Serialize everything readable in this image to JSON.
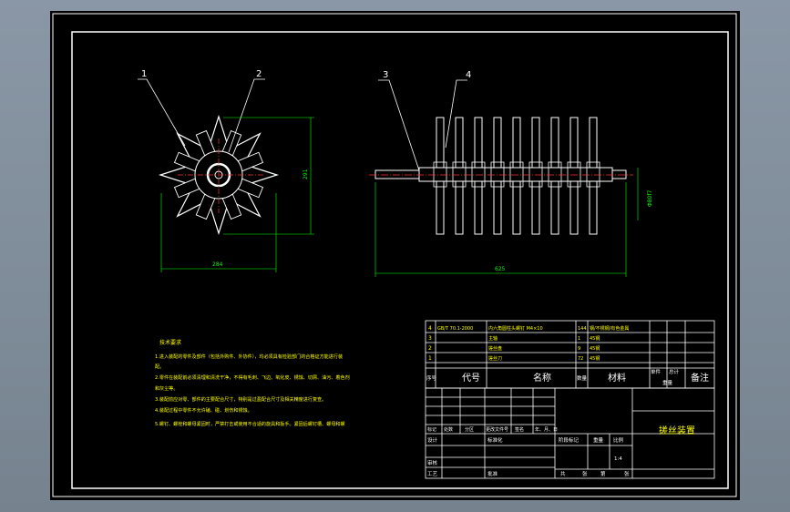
{
  "colors": {
    "background": "#000000",
    "frame": "#ffffff",
    "dimension": "#00ff00",
    "centerline": "#ff3333",
    "notes": "#ffff00",
    "chrome": "#7f8c99"
  },
  "front_view": {
    "callout_1": "1",
    "callout_2": "2",
    "dim_height": "291",
    "dim_width": "284"
  },
  "side_view": {
    "callout_3": "3",
    "callout_4": "4",
    "dim_diameter": "Φ80f7",
    "dim_length": "625"
  },
  "notes": {
    "title": "技术要求",
    "lines": [
      "1.进入装配的零件及部件（包括外购件、外协件），均必须具有检验部门的合格证方能进行装",
      "配。",
      "2.零件在装配前必须清理和清洗干净，不得有毛刺、飞边、氧化皮、锈蚀、切屑、油污、着色剂",
      "和灰尘等。",
      "3.装配前应对零、部件的主要配合尺寸，特别是过盈配合尺寸及相关精度进行复查。",
      "4.装配过程中零件不允许磕、碰、划伤和锈蚀。",
      "5.螺钉、螺栓和螺母紧固时，严禁打击或使用不合适的旋具和扳手。紧固后螺钉槽、螺母和螺"
    ]
  },
  "bom": {
    "rows": [
      {
        "seq": "4",
        "code": "GB/T 70.1-2000",
        "name": "内六角圆柱头螺钉 M4×10",
        "qty": "144",
        "material": "钢/不锈钢/有色金属"
      },
      {
        "seq": "3",
        "code": "",
        "name": "主轴",
        "qty": "1",
        "material": "45钢"
      },
      {
        "seq": "2",
        "code": "",
        "name": "搓丝盘",
        "qty": "9",
        "material": "45钢"
      },
      {
        "seq": "1",
        "code": "",
        "name": "搓丝刀",
        "qty": "72",
        "material": "45钢"
      }
    ],
    "header": {
      "seq": "序号",
      "code": "代号",
      "name": "名称",
      "qty": "数量",
      "material": "材料",
      "single": "单件",
      "total": "总计",
      "weight": "重量",
      "remark": "备注"
    }
  },
  "title_block": {
    "title": "搓丝装置",
    "row_labels": [
      "标记",
      "处数",
      "分区",
      "更改文件号",
      "签名",
      "年、月、日"
    ],
    "design": "设计",
    "standardize": "标准化",
    "review": "审核",
    "process": "工艺",
    "approve": "批准",
    "stage_label": "阶段标记",
    "weight_label": "重量",
    "scale_label": "比例",
    "scale": "1:4",
    "sheets": "共",
    "sheet_unit": "张",
    "page": "第",
    "page_unit": "张"
  }
}
